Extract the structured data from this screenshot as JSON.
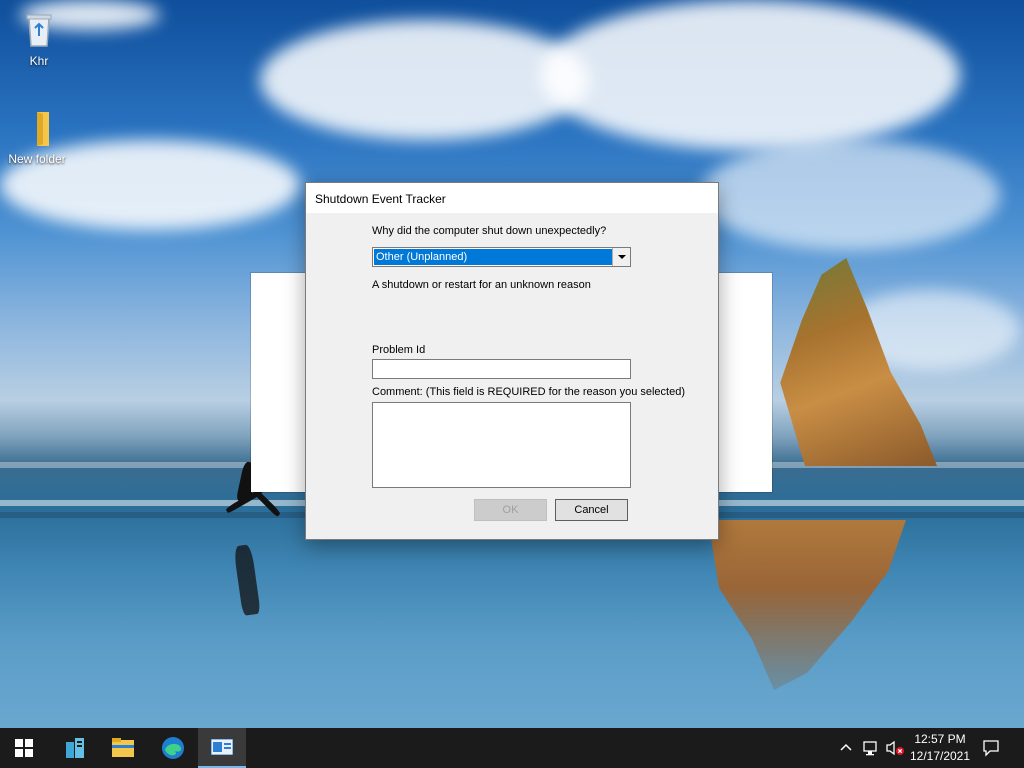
{
  "desktop": {
    "icons": [
      {
        "label": "Khr",
        "icon": "recycle-bin-icon"
      },
      {
        "label": "New folder",
        "icon": "folder-icon"
      }
    ]
  },
  "dialog": {
    "title": "Shutdown Event Tracker",
    "question": "Why did the computer shut down unexpectedly?",
    "reason_selected": "Other (Unplanned)",
    "reason_description": "A shutdown or restart for an unknown reason",
    "problem_id_label": "Problem Id",
    "problem_id_value": "",
    "comment_label": "Comment: (This field is REQUIRED for the reason you selected)",
    "comment_value": "",
    "ok_label": "OK",
    "cancel_label": "Cancel"
  },
  "taskbar": {
    "buttons": [
      "start-icon",
      "server-manager-icon",
      "file-explorer-icon",
      "edge-icon",
      "shutdown-tracker-icon"
    ],
    "time": "12:57 PM",
    "date": "12/17/2021",
    "tray_icons": [
      "chevron-up-icon",
      "network-icon",
      "volume-muted-icon",
      "notifications-icon"
    ]
  },
  "colors": {
    "selection": "#0078d7",
    "taskbar": "#1b1b1b",
    "dialog_bg": "#f0f0f0"
  }
}
